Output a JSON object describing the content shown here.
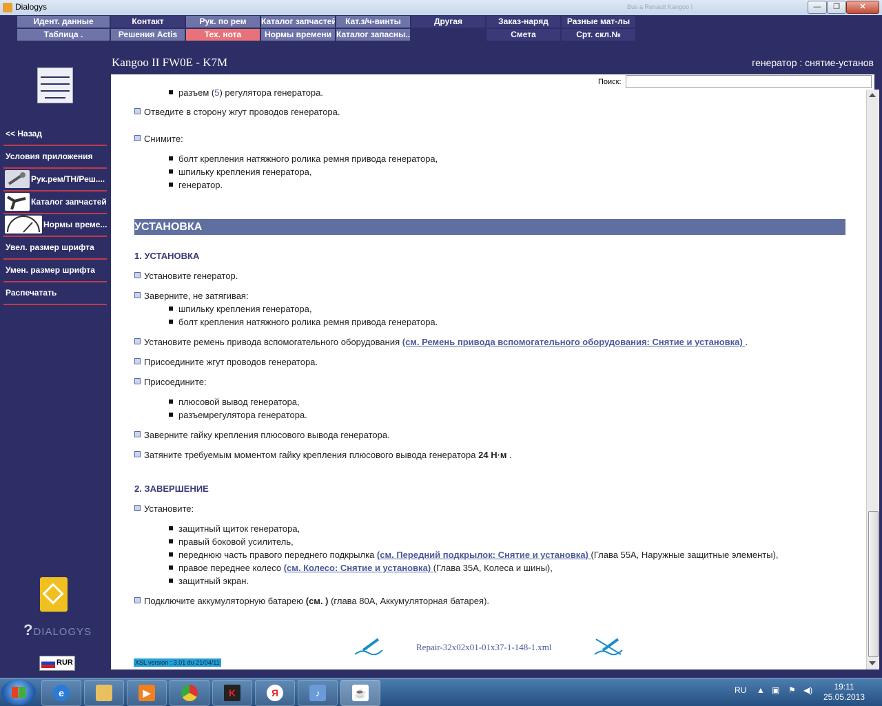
{
  "window": {
    "title": "Dialogys",
    "ghost_title": "Bus a Renault Kangoo I",
    "min_glyph": "—",
    "max_glyph": "❐",
    "close_glyph": "✕"
  },
  "menu": {
    "row1": [
      "Идент. данные",
      "Контакт",
      "Рук. по рем",
      "Каталог запчастей",
      "Кат.з/ч-винты",
      "Другая",
      "Заказ-наряд",
      "Разные мат-лы"
    ],
    "row2": [
      "Таблица .",
      "Решения Actis",
      "Тех. нота",
      "Нормы времени",
      "Каталог запасны...",
      "Смета",
      "Срт. скл.№"
    ],
    "active": "Тех. нота"
  },
  "sidebar": {
    "items": [
      {
        "label": "<< Назад"
      },
      {
        "label": "Условия приложения"
      },
      {
        "label": "Рук.рем/ТН/Реш....",
        "icon": "wrench-icon"
      },
      {
        "label": "Каталог запчастей",
        "icon": "parts-icon"
      },
      {
        "label": "Нормы време...",
        "icon": "gauge-icon"
      },
      {
        "label": "Увел. размер шрифта"
      },
      {
        "label": "Умен. размер шрифта"
      },
      {
        "label": "Распечатать"
      }
    ],
    "brand": "DIALOGYS",
    "currency": "RUR"
  },
  "header": {
    "model": "Kangoo II FW0E - K7M",
    "subject": "генератор : снятие-установ"
  },
  "search": {
    "label": "Поиск:",
    "value": ""
  },
  "doc": {
    "cut_line_pre": "разъем (",
    "cut_line_num": "5",
    "cut_line_post": ") регулятора генератора.",
    "step_harness_aside": "Отведите в сторону жгут проводов генератора.",
    "remove_label": "Снимите:",
    "remove_items": [
      "болт крепления натяжного ролика ремня привода генератора,",
      "шпильку крепления генератора,",
      "генератор."
    ],
    "section_title": "УСТАНОВКА",
    "sub1": "1. УСТАНОВКА",
    "install_gen": "Установите генератор.",
    "screw_label": "Заверните, не затягивая:",
    "screw_items": [
      "шпильку крепления генератора,",
      "болт крепления натяжного ролика ремня привода генератора."
    ],
    "belt_text": "Установите ремень привода вспомогательного оборудования ",
    "belt_link": "(см. Ремень привода вспомогательного оборудования: Снятие и установка) ",
    "belt_tail": ".",
    "connect_harness": "Присоедините жгут проводов генератора.",
    "connect_label": "Присоедините:",
    "connect_items": [
      "плюсовой вывод генератора,",
      "разъемрегулятора генератора."
    ],
    "nut_text": "Заверните гайку крепления плюсового вывода генератора.",
    "torque_text": "Затяните требуемым моментом гайку крепления плюсового вывода генератора ",
    "torque_value": "24 Н·м",
    "torque_tail": " .",
    "sub2": "2. ЗАВЕРШЕНИЕ",
    "final_label": "Установите:",
    "final_1": "защитный щиток генератора,",
    "final_2": "правый боковой усилитель,",
    "final_3_pre": "переднюю часть правого переднего подкрылка ",
    "final_3_link": "(см. Передний подкрылок: Снятие и установка) ",
    "final_3_post": "(Глава 55А, Наружные защитные элементы),",
    "final_4_pre": "правое переднее колесо ",
    "final_4_link": "(см. Колесо: Снятие и установка) ",
    "final_4_post": "(Глава 35А, Колеса и шины),",
    "final_5": "защитный экран.",
    "battery_pre": "Подключите аккумуляторную батарею ",
    "battery_bold": "(см. )",
    "battery_post": " (глава 80А, Аккумуляторная батарея).",
    "file_name": "Repair-32x02x01-01x37-1-148-1.xml",
    "xsl_version": "XSL version : 3.01 du 21/04/11"
  },
  "taskbar": {
    "apps": [
      "ie-icon",
      "explorer-icon",
      "media-icon",
      "chrome-icon",
      "kaspersky-icon",
      "yandex-icon",
      "audio-icon",
      "java-icon"
    ],
    "lang": "RU",
    "time": "19:11",
    "date": "25.05.2013"
  },
  "colors": {
    "background": "#2e2e66",
    "accent_red": "#c03a4a",
    "menu_active": "#e8727a",
    "section_bar": "#5e6fa0",
    "link": "#4a5a9a"
  }
}
